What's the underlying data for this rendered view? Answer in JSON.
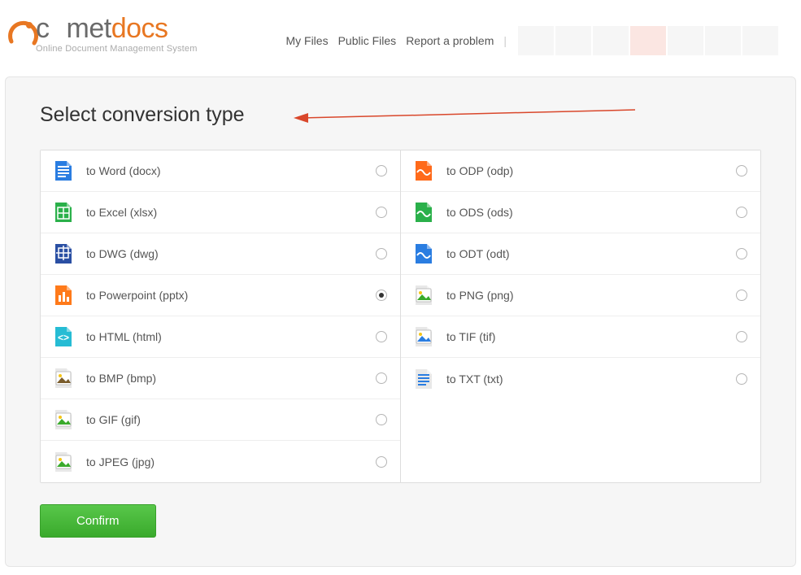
{
  "logo": {
    "pre": "c",
    "mid": "met",
    "post": "docs",
    "tagline": "Online Document Management System"
  },
  "nav": {
    "my_files": "My Files",
    "public_files": "Public Files",
    "report": "Report a problem",
    "extra": "|"
  },
  "title": "Select conversion type",
  "options_left": [
    {
      "label": "to Word (docx)",
      "icon": "word-icon",
      "bg": "#2a7de1",
      "glyph": "lines-white"
    },
    {
      "label": "to Excel (xlsx)",
      "icon": "excel-icon",
      "bg": "#2ab04a",
      "glyph": "grid-white"
    },
    {
      "label": "to DWG (dwg)",
      "icon": "dwg-icon",
      "bg": "#2a4fa3",
      "glyph": "cross-white"
    },
    {
      "label": "to Powerpoint (pptx)",
      "icon": "powerpoint-icon",
      "bg": "#ff7a1a",
      "glyph": "bars-white",
      "selected": true
    },
    {
      "label": "to HTML (html)",
      "icon": "html-icon",
      "bg": "#26bcd4",
      "glyph": "code-white"
    },
    {
      "label": "to BMP (bmp)",
      "icon": "bmp-icon",
      "bg": "#e8e8e8",
      "glyph": "photo-brown"
    },
    {
      "label": "to GIF (gif)",
      "icon": "gif-icon",
      "bg": "#e8e8e8",
      "glyph": "photo-green"
    },
    {
      "label": "to JPEG (jpg)",
      "icon": "jpeg-icon",
      "bg": "#e8e8e8",
      "glyph": "photo-green"
    }
  ],
  "options_right": [
    {
      "label": "to ODP (odp)",
      "icon": "odp-icon",
      "bg": "#ff6a1a",
      "glyph": "wave-white"
    },
    {
      "label": "to ODS (ods)",
      "icon": "ods-icon",
      "bg": "#2ab04a",
      "glyph": "wave-white"
    },
    {
      "label": "to ODT (odt)",
      "icon": "odt-icon",
      "bg": "#2a7de1",
      "glyph": "wave-white"
    },
    {
      "label": "to PNG (png)",
      "icon": "png-icon",
      "bg": "#e8e8e8",
      "glyph": "photo-green"
    },
    {
      "label": "to TIF (tif)",
      "icon": "tif-icon",
      "bg": "#e8e8e8",
      "glyph": "photo-blue"
    },
    {
      "label": "to TXT (txt)",
      "icon": "txt-icon",
      "bg": "#e8e8e8",
      "glyph": "lines-blue"
    }
  ],
  "confirm": "Confirm"
}
